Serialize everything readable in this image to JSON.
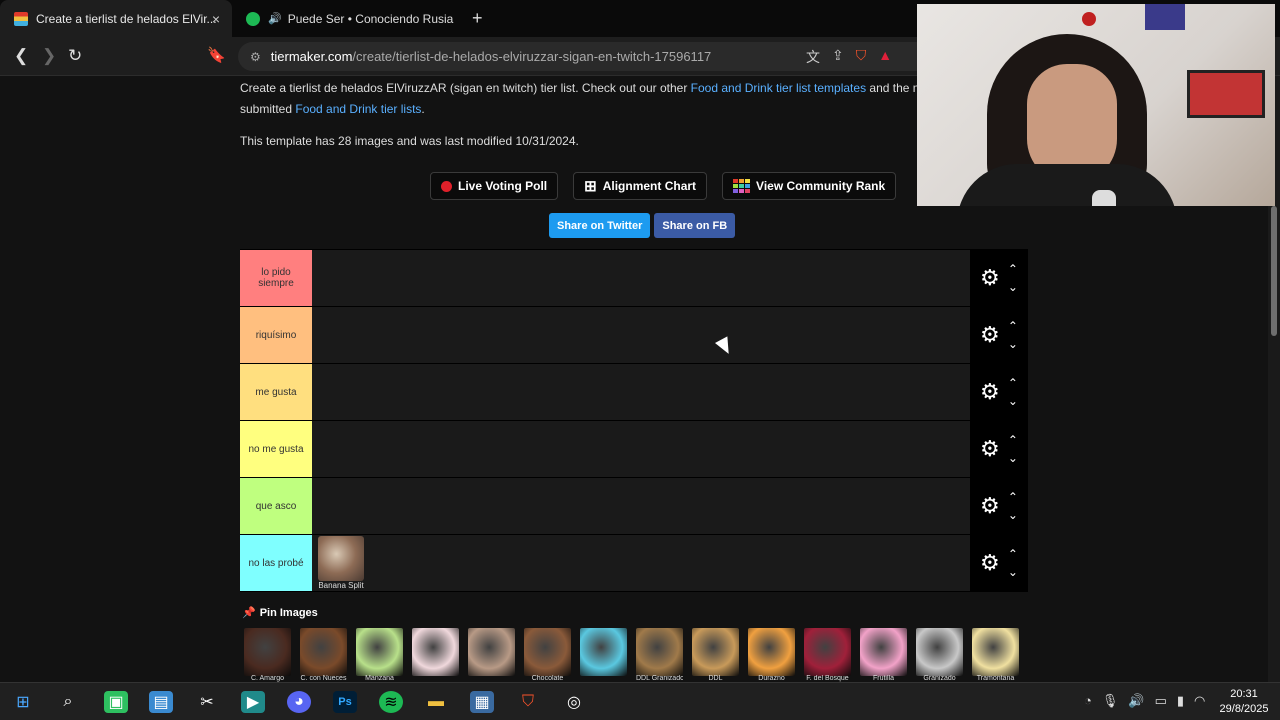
{
  "browser": {
    "tabs": [
      {
        "title": "Create a tierlist de helados ElVir...",
        "close": "×"
      },
      {
        "title": "Puede Ser • Conociendo Rusia"
      }
    ],
    "new_tab": "+",
    "url_host": "tiermaker.com",
    "url_path": "/create/tierlist-de-helados-elviruzzar-sigan-en-twitch-17596117"
  },
  "page": {
    "desc_line1_prefix": "Create a tierlist de helados ElViruzzAR (sigan en twitch) tier list. Check out our other ",
    "desc_link1": "Food and Drink tier list templates",
    "desc_line1_suffix": " and the m",
    "desc_line2_prefix": "submitted ",
    "desc_link2": "Food and Drink tier lists",
    "desc_line2_suffix": ".",
    "modified": "This template has 28 images and was last modified 10/31/2024.",
    "buttons": {
      "live_voting": "Live Voting Poll",
      "alignment": "Alignment Chart",
      "community": "View Community Rank"
    },
    "share_twitter": "Share on Twitter",
    "share_fb": "Share on FB",
    "pin_images": "Pin Images"
  },
  "tiers": [
    {
      "label": "lo pido siempre",
      "color": "#ff7f7f"
    },
    {
      "label": "riquísimo",
      "color": "#ffbf7f"
    },
    {
      "label": "me gusta",
      "color": "#ffdf7f"
    },
    {
      "label": "no me gusta",
      "color": "#ffff7f"
    },
    {
      "label": "que asco",
      "color": "#bfff7f"
    },
    {
      "label": "no las probé",
      "color": "#7fffff"
    }
  ],
  "tier_item": {
    "caption": "Banana Split"
  },
  "pool": [
    {
      "caption": "C. Amargo",
      "color": "#4a2a20"
    },
    {
      "caption": "C. con Nueces",
      "color": "#7a4a2a"
    },
    {
      "caption": "Manzana",
      "color": "#b8e08a"
    },
    {
      "caption": "",
      "color": "#f0d8dc"
    },
    {
      "caption": "",
      "color": "#b89a86"
    },
    {
      "caption": "Chocolate",
      "color": "#8a5a3a"
    },
    {
      "caption": "",
      "color": "#5ac8e0"
    },
    {
      "caption": "DDL Granizado",
      "color": "#a07a4a"
    },
    {
      "caption": "DDL",
      "color": "#c89a5a"
    },
    {
      "caption": "Durazno",
      "color": "#f0a040"
    },
    {
      "caption": "F. del Bosque",
      "color": "#a0203a"
    },
    {
      "caption": "Frutilla",
      "color": "#f2a2c8"
    },
    {
      "caption": "Granizado",
      "color": "#c8c8c8"
    },
    {
      "caption": "Tramontana",
      "color": "#f0e0a0"
    }
  ],
  "taskbar": {
    "time": "20:31",
    "date": "29/8/2025"
  }
}
